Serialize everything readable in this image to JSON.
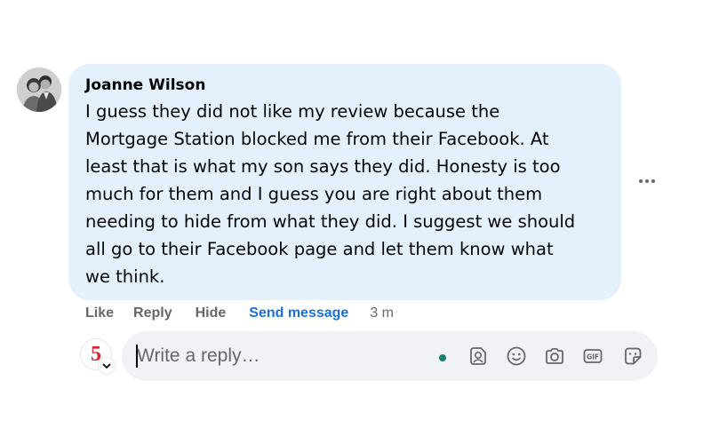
{
  "comment": {
    "author": "Joanne Wilson",
    "lines": [
      "I guess they did not like my review because the",
      "Mortgage Station blocked me from their Facebook. At",
      "least that is what my son says they did. Honesty is too",
      "much for them and I guess you are right about them",
      "needing to hide from what they did. I suggest we should",
      "all go to their Facebook page and let them know what",
      "we think."
    ],
    "bubble_color": "#e4f0fb"
  },
  "actions": {
    "like": "Like",
    "reply": "Reply",
    "hide": "Hide",
    "send_message": "Send message",
    "time": "3 m",
    "send_color": "#1d6fd6"
  },
  "reply_composer": {
    "placeholder": "Write a reply…",
    "avatar_text": "5",
    "icons": [
      "avatar-sticker-icon",
      "emoji-icon",
      "camera-icon",
      "gif-icon",
      "sticker-icon"
    ]
  }
}
